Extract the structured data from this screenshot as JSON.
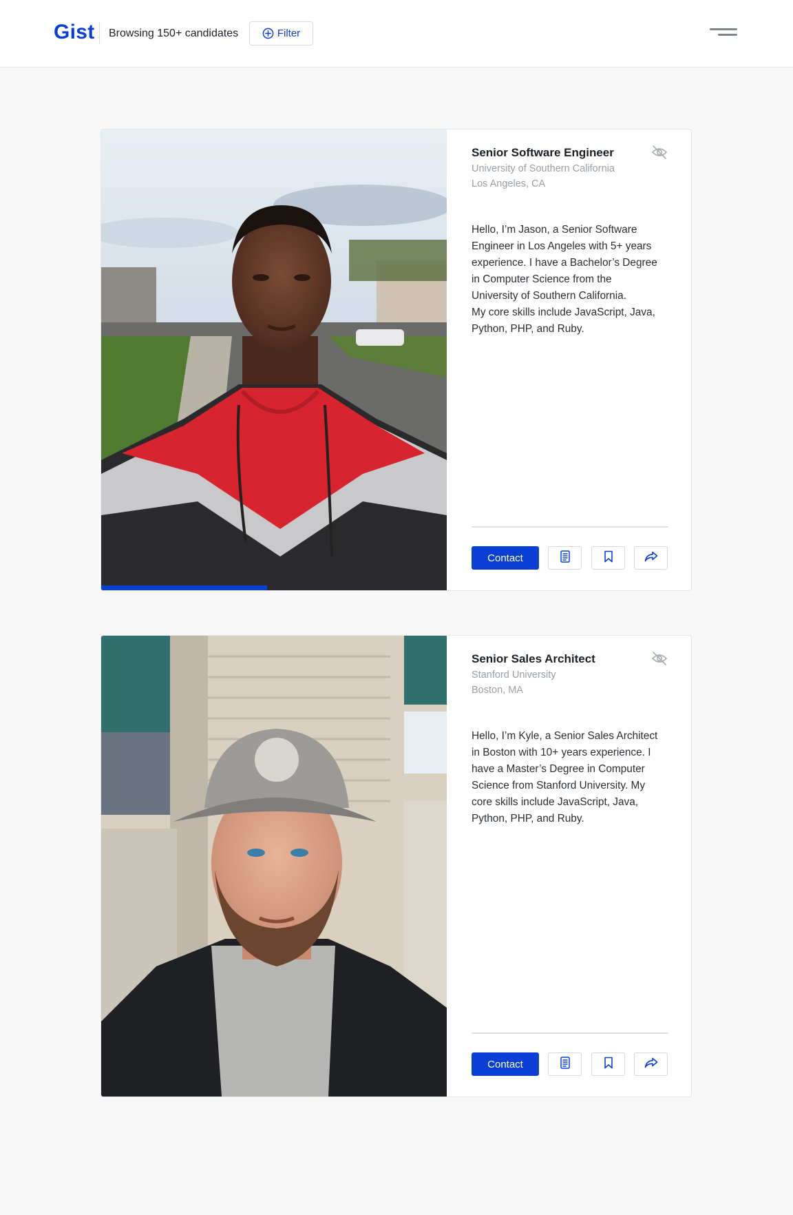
{
  "header": {
    "logo": "Gist",
    "browsing_text": "Browsing 150+ candidates",
    "filter_label": "Filter"
  },
  "colors": {
    "accent": "#0a3fd6",
    "muted_text": "#9a9ea6",
    "page_background": "#f8f8f9"
  },
  "candidates": [
    {
      "title": "Senior Software Engineer",
      "school": "University of Southern California",
      "location": "Los Angeles, CA",
      "bio": "Hello, I’m Jason, a Senior Software\nEngineer in Los Angeles with 5+ years\nexperience. I have a Bachelor’s Degree\nin Computer Science from the\nUniversity of Southern California.\nMy core skills include JavaScript, Java,\nPython, PHP, and Ruby.",
      "contact_label": "Contact",
      "photo_progress": 0.48,
      "icons": [
        "eye-off-icon",
        "document-icon",
        "bookmark-icon",
        "share-icon"
      ]
    },
    {
      "title": "Senior Sales Architect",
      "school": "Stanford University",
      "location": "Boston, MA",
      "bio": "Hello, I’m Kyle, a Senior Sales Architect\nin Boston with 10+ years experience. I\nhave a Master’s Degree in Computer\nScience from Stanford University. My\ncore skills include JavaScript, Java,\nPython, PHP, and Ruby.",
      "contact_label": "Contact",
      "icons": [
        "eye-off-icon",
        "document-icon",
        "bookmark-icon",
        "share-icon"
      ]
    }
  ]
}
